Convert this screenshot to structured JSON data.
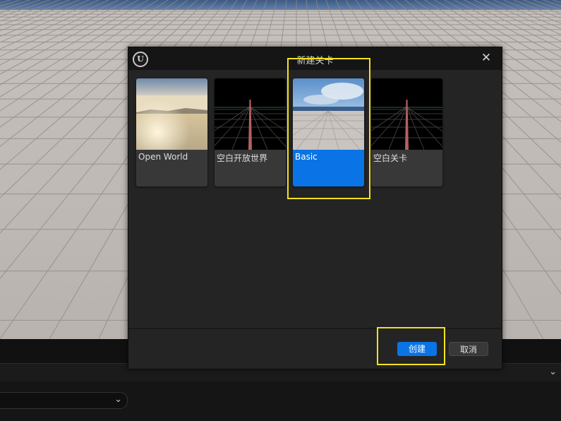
{
  "dialog": {
    "title": "新建关卡",
    "close_icon": "close-icon",
    "logo_icon": "unreal-logo-icon",
    "logo_glyph": "U"
  },
  "templates": [
    {
      "label": "Open World",
      "thumbnail": "open-world-thumbnail",
      "selected": false
    },
    {
      "label": "空白开放世界",
      "thumbnail": "empty-open-world-thumbnail",
      "selected": false
    },
    {
      "label": "Basic",
      "thumbnail": "basic-thumbnail",
      "selected": true
    },
    {
      "label": "空白关卡",
      "thumbnail": "empty-level-thumbnail",
      "selected": false
    }
  ],
  "footer": {
    "create_label": "创建",
    "cancel_label": "取消"
  },
  "background": {
    "dropdown_chevron_icon": "chevron-down-icon",
    "dropdown_chevron_glyph": "⌄",
    "panel_chevron_glyph": "⌄"
  },
  "colors": {
    "accent": "#0a74e6",
    "highlight": "#f2e21d",
    "dialog_bg": "#242424",
    "titlebar_bg": "#151515"
  }
}
